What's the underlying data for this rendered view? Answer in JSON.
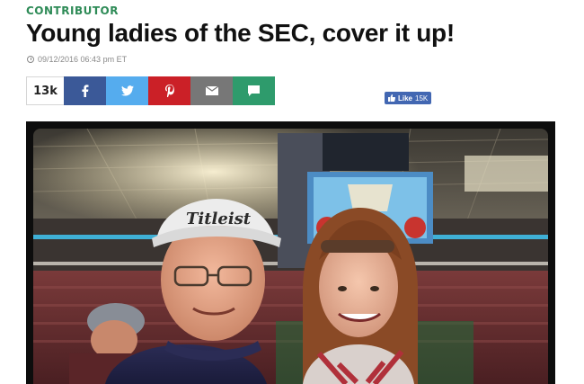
{
  "article": {
    "kicker": "CONTRIBUTOR",
    "headline": "Young ladies of the SEC, cover it up!",
    "timestamp": "09/12/2016 06:43 pm ET"
  },
  "share": {
    "count": "13k",
    "buttons": [
      {
        "name": "facebook",
        "icon": "facebook-icon",
        "color": "#3b5998"
      },
      {
        "name": "twitter",
        "icon": "twitter-icon",
        "color": "#55acee"
      },
      {
        "name": "pinterest",
        "icon": "pinterest-icon",
        "color": "#cb2027"
      },
      {
        "name": "email",
        "icon": "envelope-icon",
        "color": "#777777"
      },
      {
        "name": "comment",
        "icon": "comment-icon",
        "color": "#2e9b6c"
      }
    ]
  },
  "facebook_like": {
    "label": "Like",
    "count": "15K",
    "color": "#4267b2"
  },
  "photo": {
    "cap_text": "Titleist"
  }
}
